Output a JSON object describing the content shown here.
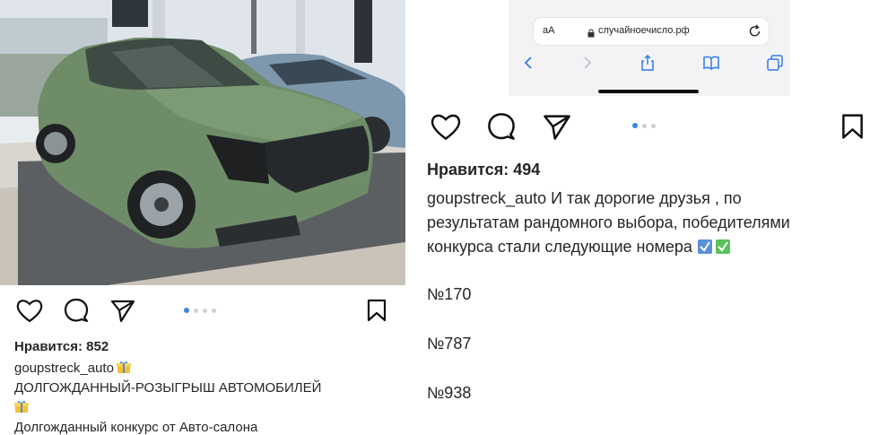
{
  "left_post": {
    "likes": "Нравится: 852",
    "username": "goupstreck_auto",
    "caption_line1": "ДОЛГОЖДАННЫЙ-РОЗЫГРЫШ АВТОМОБИЛЕЙ",
    "caption_line2": "Долгожданный конкурс от Авто-салона",
    "icons": [
      "heart-icon",
      "comment-icon",
      "send-icon",
      "bookmark-icon",
      "gift-emoji"
    ]
  },
  "right_post": {
    "browser": {
      "text_size_label": "аА",
      "url": "случайноечисло.рф",
      "icons": [
        "lock-icon",
        "reload-icon",
        "back-icon",
        "forward-icon",
        "share-icon",
        "bookmarks-icon",
        "tabs-icon"
      ]
    },
    "likes": "Нравится: 494",
    "username": "goupstreck_auto",
    "caption_line1": "И так дорогие друзья , по",
    "caption_line2": "результатам рандомного выбора, победителями",
    "caption_line3": "конкурса стали следующие номера",
    "numbers": [
      "№170",
      "№787",
      "№938"
    ],
    "icons": [
      "heart-icon",
      "comment-icon",
      "send-icon",
      "bookmark-icon",
      "check-mark-emoji"
    ]
  },
  "colors": {
    "dot_active": "#3b86e0",
    "dot_inactive": "#cfcfcf",
    "text": "#262626",
    "car_green": "#6f8c69"
  }
}
